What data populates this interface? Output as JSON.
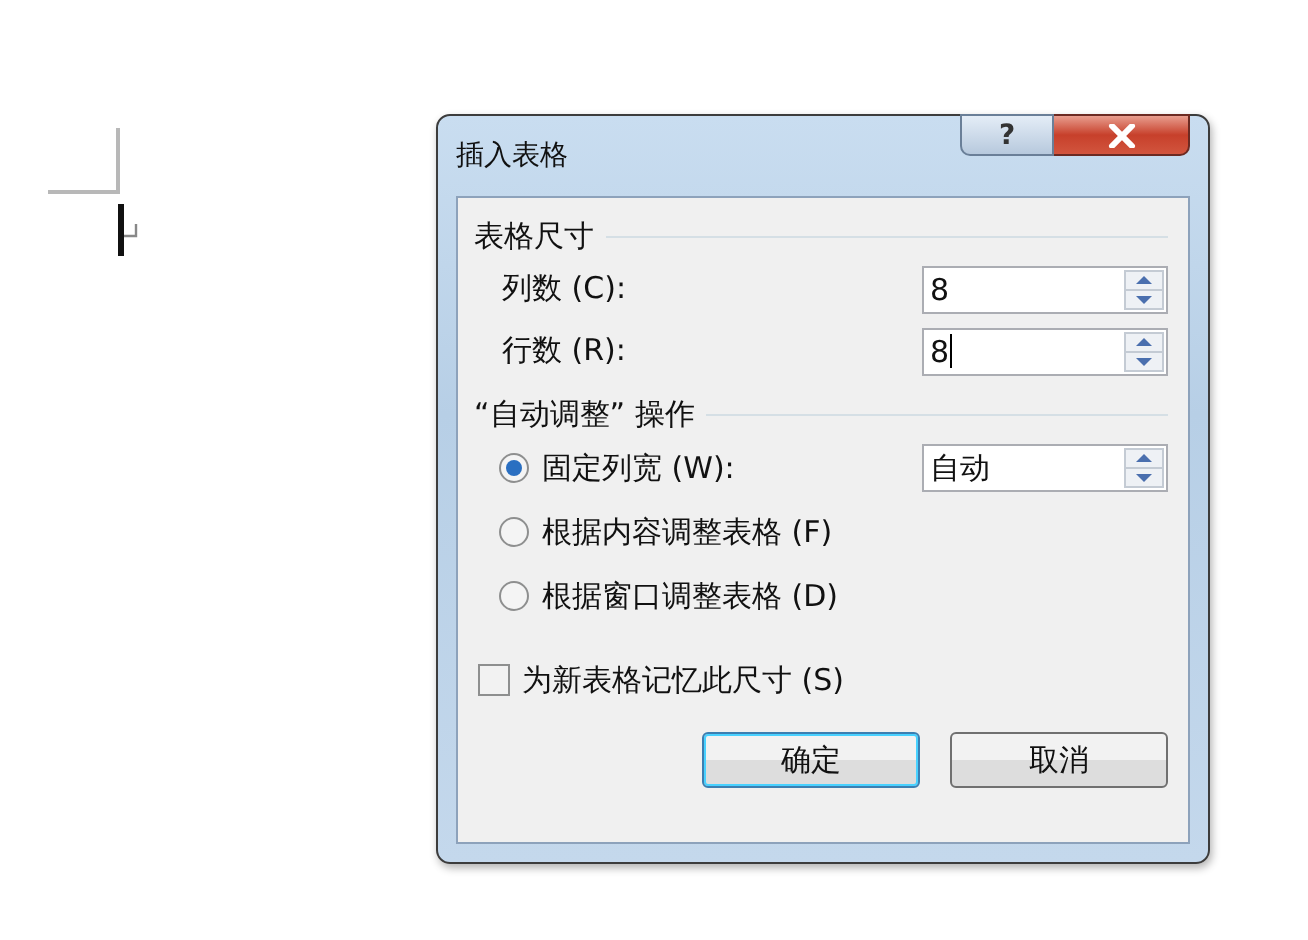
{
  "dialog": {
    "title": "插入表格",
    "help_button": "?"
  },
  "table_size": {
    "title": "表格尺寸",
    "fields": [
      {
        "label": "列数 (C):",
        "value": "8",
        "focused": false
      },
      {
        "label": "行数 (R):",
        "value": "8",
        "focused": true
      }
    ]
  },
  "autofit": {
    "title": "“自动调整” 操作",
    "options": [
      {
        "label": "固定列宽 (W):",
        "selected": true,
        "value": "自动"
      },
      {
        "label": "根据内容调整表格 (F)",
        "selected": false
      },
      {
        "label": "根据窗口调整表格 (D)",
        "selected": false
      }
    ]
  },
  "remember": {
    "label": "为新表格记忆此尺寸 (S)",
    "checked": false
  },
  "buttons": [
    {
      "label": "确定",
      "default": true
    },
    {
      "label": "取消",
      "default": false
    }
  ]
}
